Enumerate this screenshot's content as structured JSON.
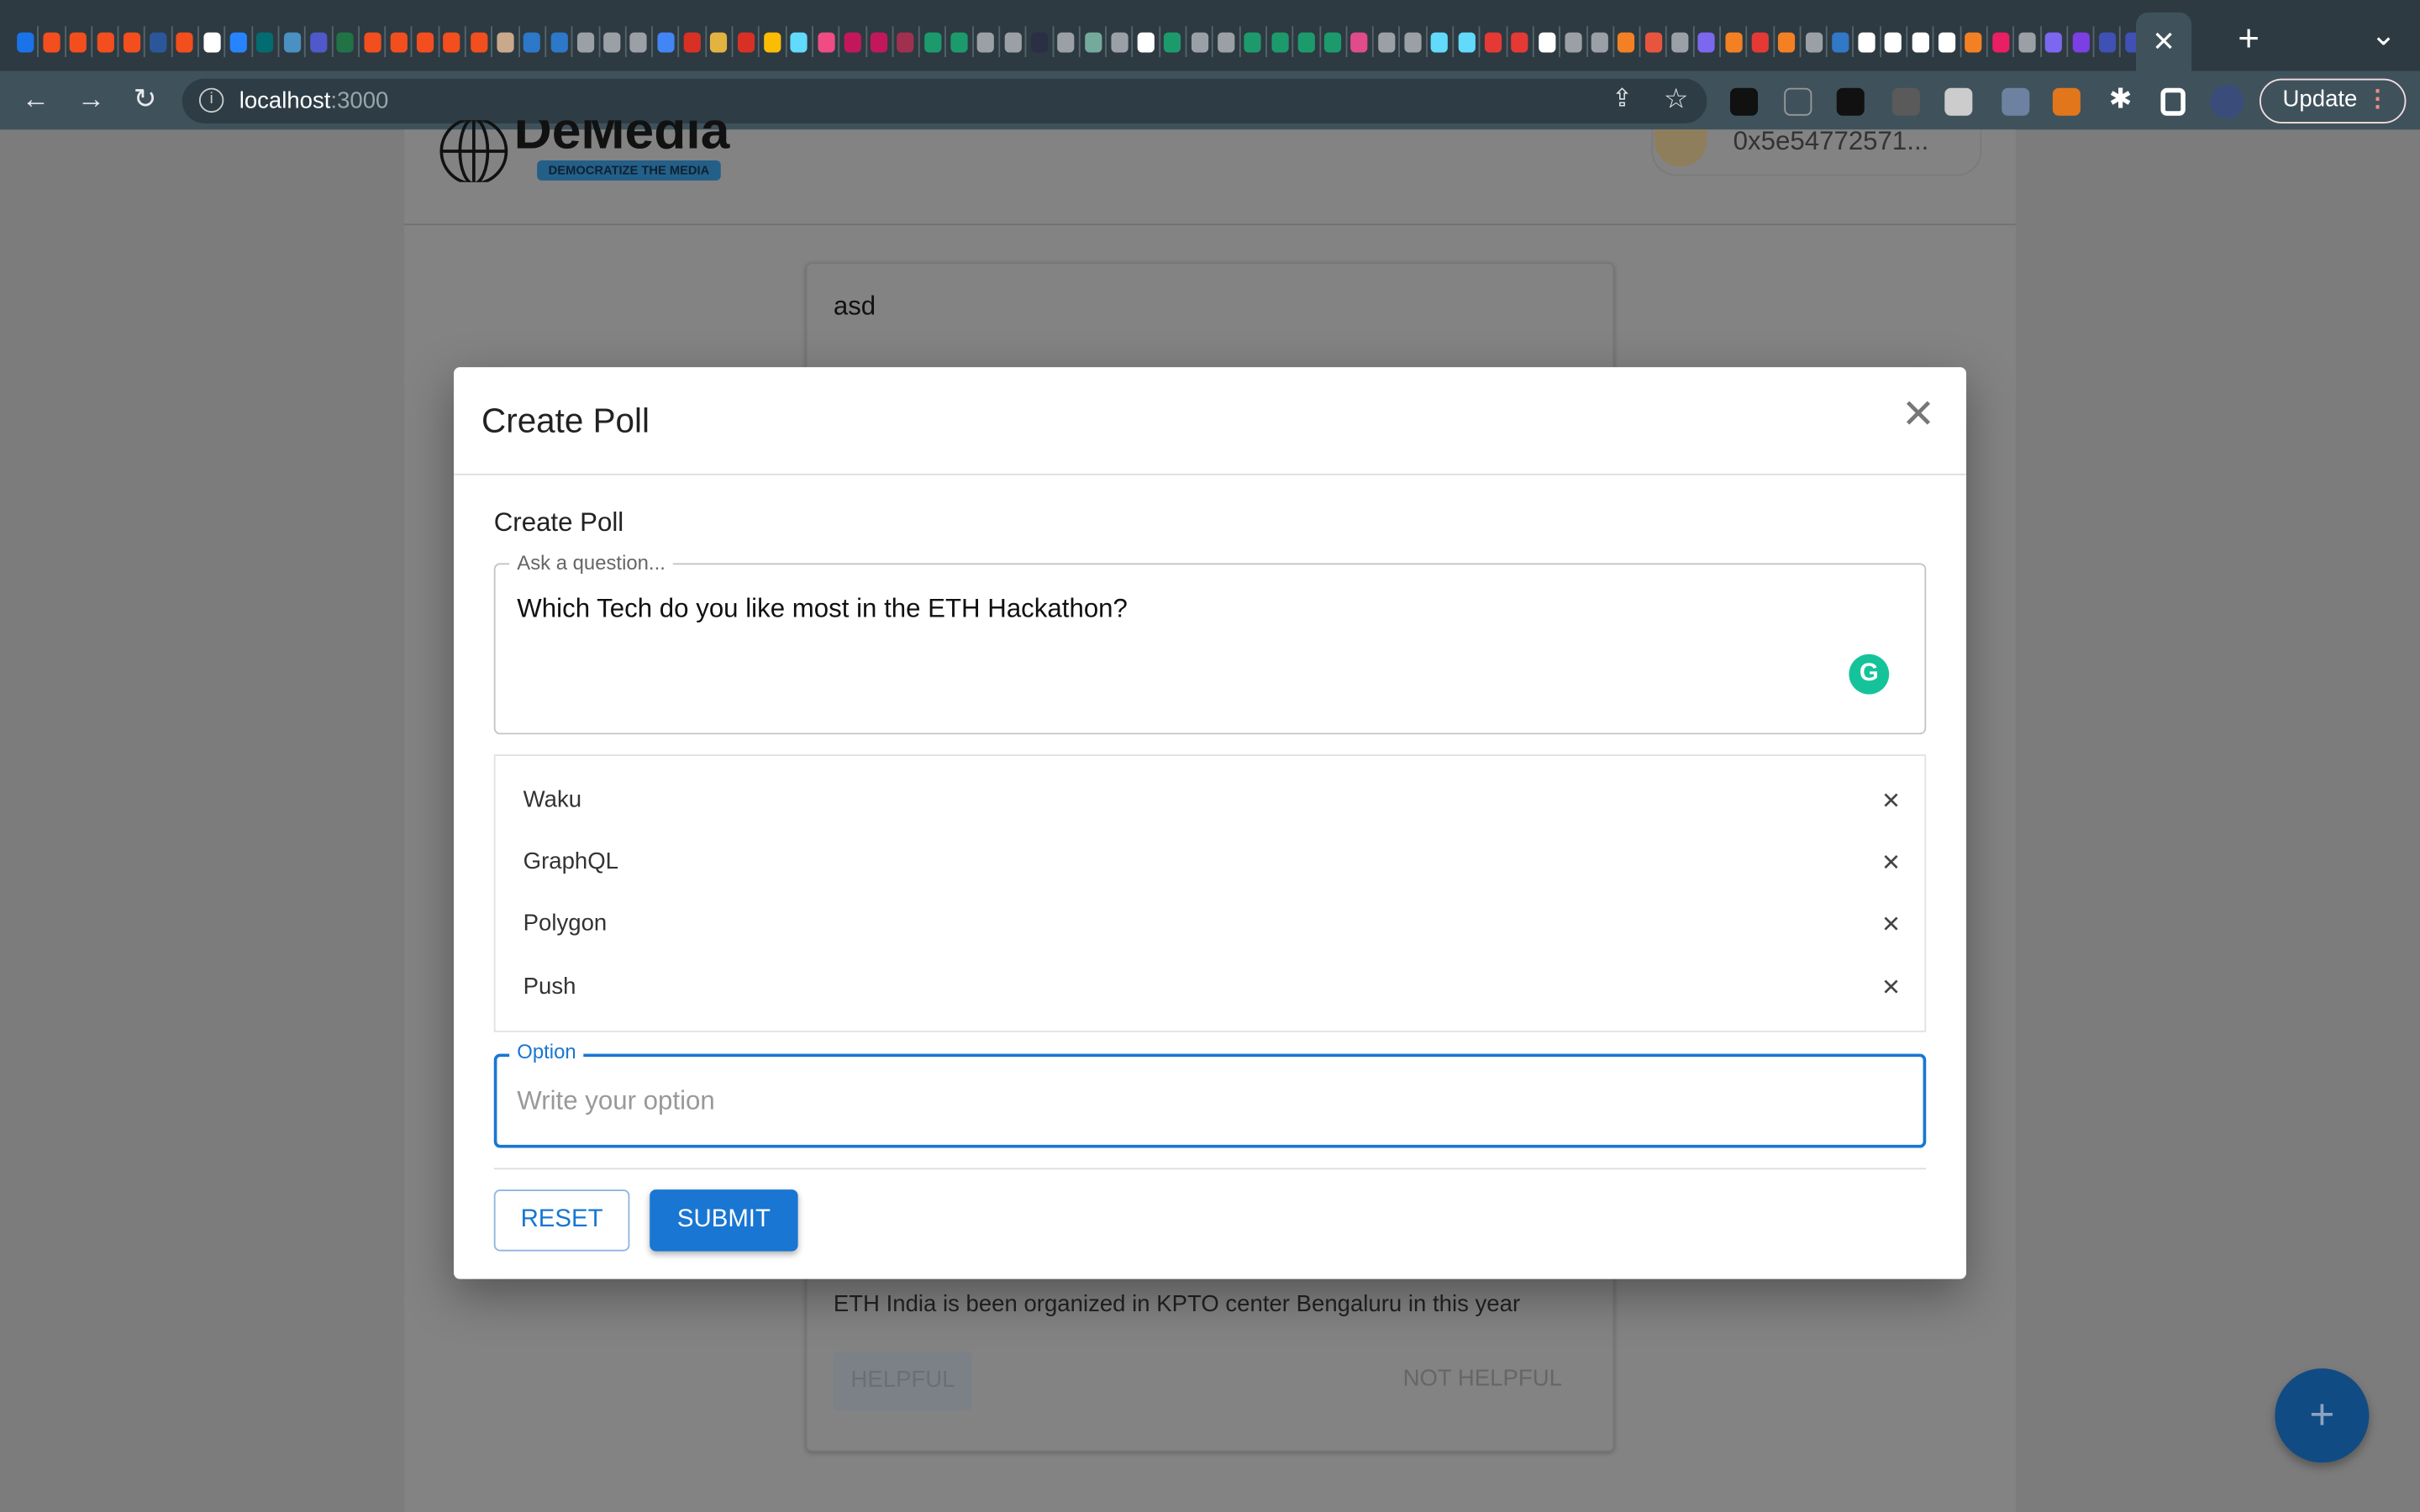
{
  "browser": {
    "url_host": "localhost",
    "url_port": ":3000",
    "update_label": "Update",
    "tab_favicon_colors": [
      "#1a73e8",
      "#f24e1e",
      "#f24e1e",
      "#f24e1e",
      "#f24e1e",
      "#2b579a",
      "#f24e1e",
      "#ffffff",
      "#2684ff",
      "#036c70",
      "#4a90c2",
      "#5059c9",
      "#217346",
      "#f24e1e",
      "#f24e1e",
      "#f24e1e",
      "#f24e1e",
      "#f24e1e",
      "#c9a98b",
      "#2d78c8",
      "#2d78c8",
      "#9aa0a6",
      "#9aa0a6",
      "#9aa0a6",
      "#4285f4",
      "#d93025",
      "#e3b341",
      "#d93025",
      "#fbbc04",
      "#61dafb",
      "#ef4c84",
      "#c2185b",
      "#c2185b",
      "#a03050",
      "#1d9a6c",
      "#1d9a6c",
      "#9aa0a6",
      "#9aa0a6",
      "#2a2f45",
      "#9aa0a6",
      "#74aa9c",
      "#9aa0a6",
      "#ffffff",
      "#1d9a6c",
      "#9aa0a6",
      "#9aa0a6",
      "#1d9a6c",
      "#1d9a6c",
      "#1d9a6c",
      "#1d9a6c",
      "#e04b8b",
      "#9aa0a6",
      "#9aa0a6",
      "#61dafb",
      "#61dafb",
      "#e53935",
      "#e53935",
      "#ffffff",
      "#9aa0a6",
      "#9aa0a6",
      "#f48024",
      "#e8553e",
      "#9aa0a6",
      "#7b68ee",
      "#f48024",
      "#e53935",
      "#f48024",
      "#9aa0a6",
      "#3178c6",
      "#ffffff",
      "#ffffff",
      "#ffffff",
      "#ffffff",
      "#f48024",
      "#e91e63",
      "#9aa0a6",
      "#7b68ee",
      "#7b3fe4",
      "#3f51b5",
      "#3f51b5"
    ],
    "active_tab_close": "✕",
    "new_tab": "+",
    "tab_list": "⌄"
  },
  "app": {
    "logo_text": "DeMedia",
    "logo_tagline": "DEMOCRATIZE THE MEDIA",
    "wallet_address": "0x5e54772571...",
    "card_title": "asd",
    "card_text": "ETH India is been organized in KPTO center Bengaluru in this year",
    "helpful_label": "HELPFUL",
    "not_helpful_label": "NOT HELPFUL",
    "fab_label": "+"
  },
  "modal": {
    "title": "Create Poll",
    "close_icon": "✕",
    "section_title": "Create Poll",
    "question_label": "Ask a question...",
    "question_value": "Which Tech do you like most in the ETH Hackathon?",
    "options": [
      {
        "label": "Waku"
      },
      {
        "label": "GraphQL"
      },
      {
        "label": "Polygon"
      },
      {
        "label": "Push"
      }
    ],
    "option_label": "Option",
    "option_placeholder": "Write your option",
    "reset_label": "RESET",
    "submit_label": "SUBMIT",
    "accent_color": "#1976d2"
  }
}
